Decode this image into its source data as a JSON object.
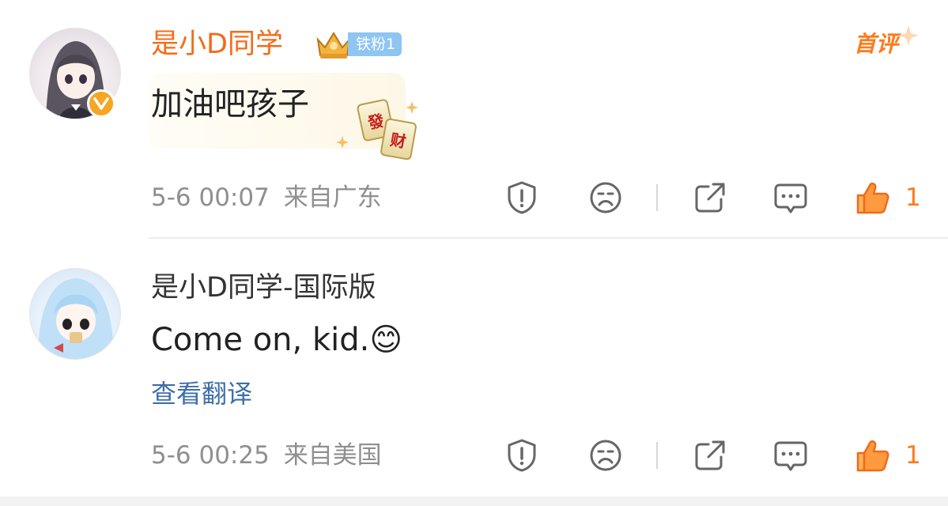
{
  "comments": [
    {
      "username": "是小D同学",
      "fan_badge": "铁粉1",
      "first_comment_label": "首评",
      "text": "加油吧孩子",
      "sticker_tiles": [
        "發",
        "财"
      ],
      "timestamp": "5-6 00:07",
      "location": "来自广东",
      "like_count": "1"
    },
    {
      "username": "是小D同学-国际版",
      "text": "Come on, kid.😊",
      "translate_label": "查看翻译",
      "timestamp": "5-6 00:25",
      "location": "来自美国",
      "like_count": "1"
    }
  ],
  "colors": {
    "vip_name": "#f56b18",
    "accent_orange": "#ff7a1a",
    "link_blue": "#3d6fa8",
    "meta_gray": "#8f8f8f"
  },
  "icons": [
    "report-icon",
    "dislike-icon",
    "share-icon",
    "comment-icon",
    "like-icon",
    "verified-badge-icon",
    "crown-icon"
  ]
}
